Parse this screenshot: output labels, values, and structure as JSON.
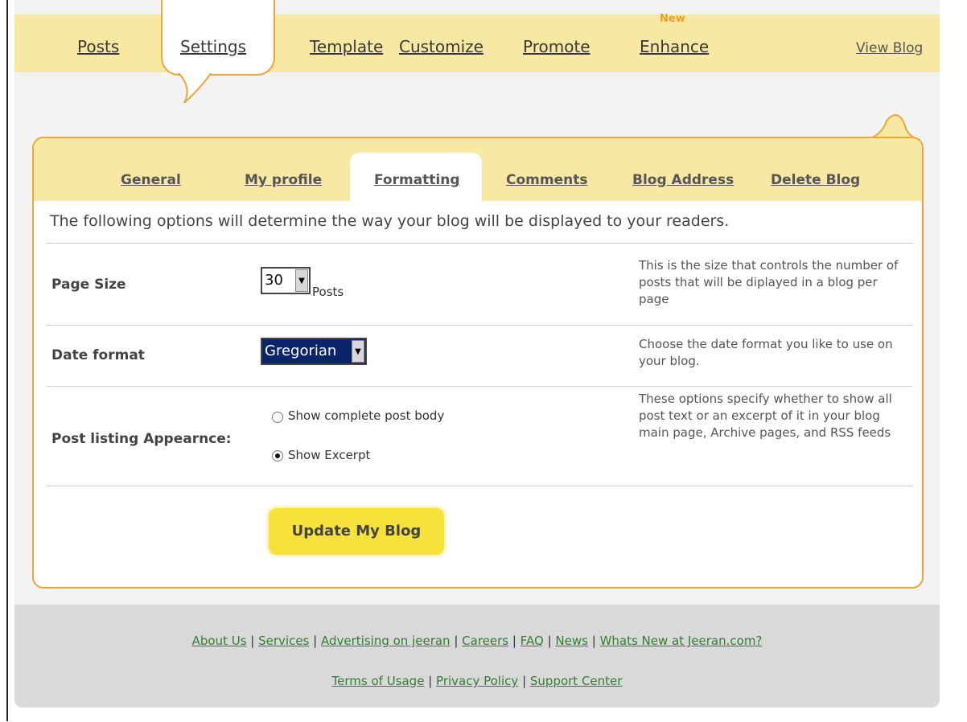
{
  "topnav": {
    "tabs": [
      {
        "label": "Posts"
      },
      {
        "label": "Settings"
      },
      {
        "label": "Template"
      },
      {
        "label": "Customize"
      },
      {
        "label": "Promote"
      },
      {
        "label": "Enhance"
      }
    ],
    "new_badge": "New",
    "view_blog": "View Blog"
  },
  "subnav": {
    "tabs": [
      {
        "label": "General"
      },
      {
        "label": "My profile"
      },
      {
        "label": "Formatting"
      },
      {
        "label": "Comments"
      },
      {
        "label": "Blog Address"
      },
      {
        "label": "Delete Blog"
      }
    ],
    "active": "Formatting"
  },
  "intro": "The following options will determine the way your blog will be displayed to your readers.",
  "settings": {
    "page_size": {
      "label": "Page Size",
      "value": "30",
      "unit": "Posts",
      "description": "This is the size that controls the number of posts that will be diplayed in a blog per page"
    },
    "date_format": {
      "label": "Date format",
      "value": "Gregorian",
      "description": "Choose the date format you like to use on your blog."
    },
    "post_listing": {
      "label": "Post listing Appearnce:",
      "options": [
        {
          "label": "Show complete post body",
          "selected": false
        },
        {
          "label": "Show Excerpt",
          "selected": true
        }
      ],
      "description": "These options specify whether to show all post text or an excerpt of it in your blog main page, Archive pages, and RSS feeds"
    }
  },
  "update_button": "Update My Blog",
  "footer": {
    "row1": [
      {
        "label": "About Us"
      },
      {
        "label": "Services"
      },
      {
        "label": "Advertising on jeeran"
      },
      {
        "label": "Careers"
      },
      {
        "label": "FAQ"
      },
      {
        "label": "News"
      },
      {
        "label": "Whats New at Jeeran.com?"
      }
    ],
    "row2": [
      {
        "label": "Terms of Usage"
      },
      {
        "label": "Privacy Policy"
      },
      {
        "label": "Support Center"
      }
    ]
  },
  "colors": {
    "accent": "#f0a53a",
    "nav_bg": "#f7e9a3",
    "button": "#f6e23a",
    "footer_link": "#2f7f2f"
  }
}
